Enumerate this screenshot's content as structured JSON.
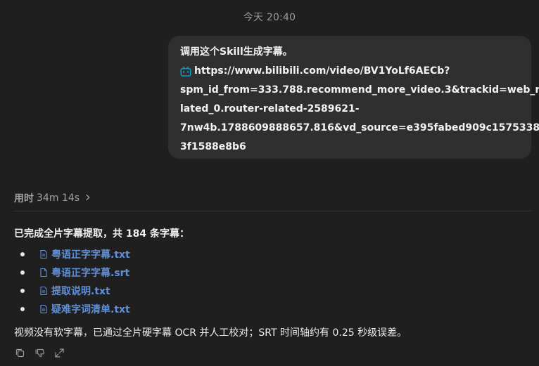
{
  "header": {
    "timestamp": "今天 20:40"
  },
  "user_message": {
    "line1": "调用这个Skill生成字幕。",
    "url": "https://www.bilibili.com/video/BV1YoLf6AECb?spm_id_from=333.788.recommend_more_video.3&trackid=web_related_0.router-related-2589621-7nw4b.1788609888657.816&vd_source=e395fabed909c15753383d3f1588e8b6",
    "url_lines": [
      "https://www.bilibili.com/video/BV1YoLf6AECb?",
      "spm_id_from=333.788.recommend_more_video.3&trackid=web_re",
      "lated_0.router-related-2589621-",
      "7nw4b.1788609888657.816&vd_source=e395fabed909c15753383d",
      "3f1588e8b6"
    ],
    "link_icon": "bilibili-tv-icon",
    "accent_color": "#00a1d6"
  },
  "assistant": {
    "duration_label": "用时",
    "duration_value": "34m 14s",
    "summary": "已完成全片字幕提取，共 184 条字幕：",
    "files": [
      {
        "name": "粤语正字字幕.txt",
        "icon": "text-file-icon"
      },
      {
        "name": "粤语正字字幕.srt",
        "icon": "file-icon"
      },
      {
        "name": "提取说明.txt",
        "icon": "text-file-icon"
      },
      {
        "name": "疑难字词清单.txt",
        "icon": "text-file-icon"
      }
    ],
    "link_color": "#5f8fd8",
    "note": "视频没有软字幕，已通过全片硬字幕 OCR 并人工校对；SRT 时间轴约有 0.25 秒级误差。",
    "actions": [
      "copy-icon",
      "thumbs-down-icon",
      "share-icon"
    ]
  }
}
